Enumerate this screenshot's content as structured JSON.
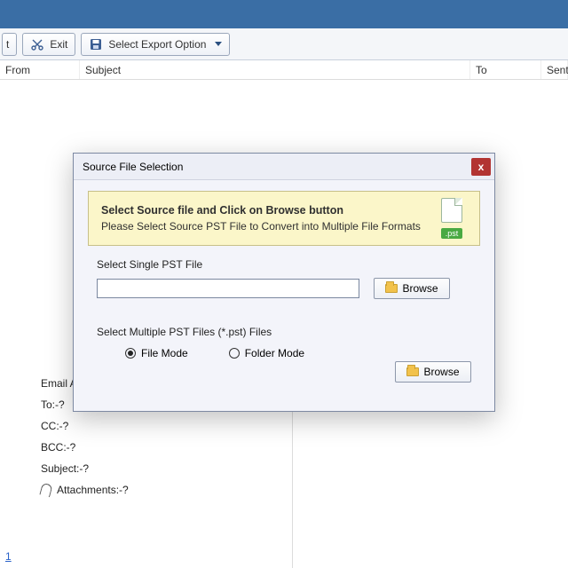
{
  "toolbar": {
    "first_fragment": "t",
    "exit_label": "Exit",
    "export_label": "Select Export Option"
  },
  "columns": {
    "from": "From",
    "subject": "Subject",
    "to": "To",
    "sent": "Sent"
  },
  "preview": {
    "email_label": "Email Ac",
    "to": "To:-?",
    "cc": "CC:-?",
    "bcc": "BCC:-?",
    "subject": "Subject:-?",
    "attachments": "Attachments:-?"
  },
  "modal": {
    "title": "Source File Selection",
    "close": "x",
    "banner_title": "Select Source file and Click on Browse button",
    "banner_sub": "Please Select Source PST File to Convert into Multiple File Formats",
    "pst_tag": ".pst",
    "single_label": "Select Single PST File",
    "browse1": "Browse",
    "multi_label": "Select Multiple PST Files (*.pst) Files",
    "radio_file": "File Mode",
    "radio_folder": "Folder Mode",
    "browse2": "Browse",
    "path_value": ""
  },
  "link": {
    "text": "1"
  }
}
